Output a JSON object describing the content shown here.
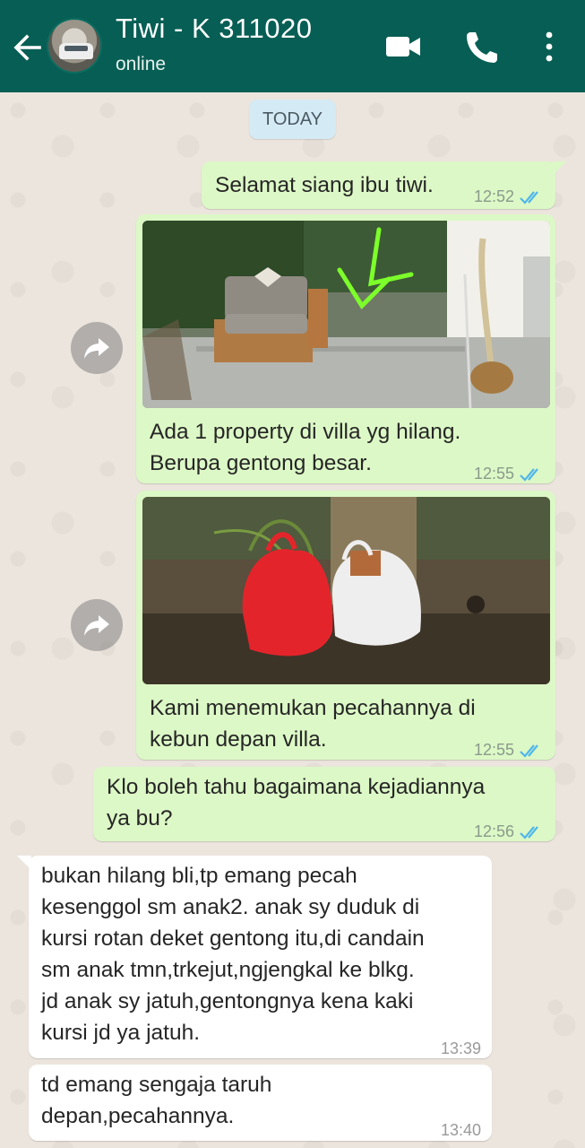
{
  "header": {
    "contact_name": "Tiwi - K 311020",
    "status": "online"
  },
  "date_chip": "TODAY",
  "messages": [
    {
      "direction": "outgoing",
      "text": "Selamat siang ibu tiwi.",
      "time": "12:52",
      "read": true
    },
    {
      "direction": "outgoing",
      "type": "image",
      "caption": "Ada 1 property di villa yg hilang.\nBerupa gentong besar.",
      "time": "12:55",
      "read": true
    },
    {
      "direction": "outgoing",
      "type": "image",
      "caption": "Kami menemukan pecahannya di\nkebun depan villa.",
      "time": "12:55",
      "read": true
    },
    {
      "direction": "outgoing",
      "text": "Klo boleh tahu bagaimana kejadiannya\nya bu?",
      "time": "12:56",
      "read": true
    },
    {
      "direction": "incoming",
      "text": "bukan hilang bli,tp emang pecah\nkesenggol sm anak2. anak sy duduk di\nkursi rotan deket gentong itu,di candain\nsm anak tmn,trkejut,ngjengkal ke blkg.\njd anak sy jatuh,gentongnya kena kaki\nkursi jd ya jatuh.",
      "time": "13:39"
    },
    {
      "direction": "incoming",
      "text": "td emang sengaja taruh\ndepan,pecahannya.",
      "time": "13:40"
    }
  ],
  "icons": {
    "back": "arrow-left-icon",
    "video": "video-camera-icon",
    "call": "phone-icon",
    "menu": "more-vert-icon",
    "forward": "forward-share-icon",
    "read_receipt": "double-check-icon"
  },
  "colors": {
    "header": "#075e54",
    "outgoing_bubble": "#dcf8c6",
    "incoming_bubble": "#ffffff",
    "read_ticks": "#4fb6ec",
    "wallpaper": "#ece5dd"
  }
}
